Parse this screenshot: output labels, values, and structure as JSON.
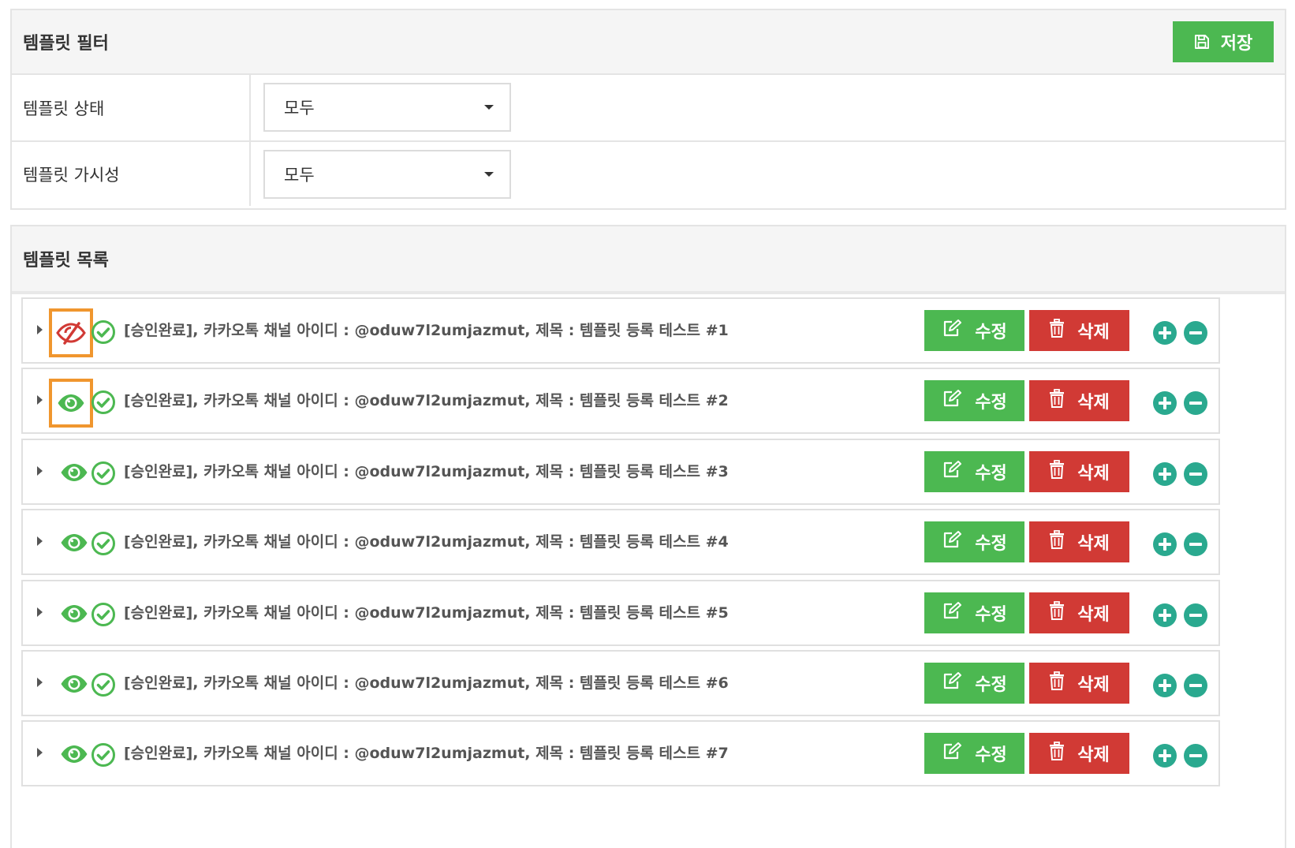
{
  "filter": {
    "title": "템플릿 필터",
    "save_label": "저장",
    "rows": [
      {
        "label": "템플릿 상태",
        "value": "모두"
      },
      {
        "label": "템플릿 가시성",
        "value": "모두"
      }
    ]
  },
  "list": {
    "title": "템플릿 목록",
    "edit_label": "수정",
    "delete_label": "삭제",
    "items": [
      {
        "title": "[승인완료], 카카오톡 채널 아이디 : @oduw7l2umjazmut, 제목 : 템플릿 등록 테스트 #1",
        "visible": false,
        "highlighted": true,
        "eye_icon": "eye-slash-icon"
      },
      {
        "title": "[승인완료], 카카오톡 채널 아이디 : @oduw7l2umjazmut, 제목 : 템플릿 등록 테스트 #2",
        "visible": true,
        "highlighted": true,
        "eye_icon": "eye-icon"
      },
      {
        "title": "[승인완료], 카카오톡 채널 아이디 : @oduw7l2umjazmut, 제목 : 템플릿 등록 테스트 #3",
        "visible": true,
        "highlighted": false,
        "eye_icon": "eye-icon"
      },
      {
        "title": "[승인완료], 카카오톡 채널 아이디 : @oduw7l2umjazmut, 제목 : 템플릿 등록 테스트 #4",
        "visible": true,
        "highlighted": false,
        "eye_icon": "eye-icon"
      },
      {
        "title": "[승인완료], 카카오톡 채널 아이디 : @oduw7l2umjazmut, 제목 : 템플릿 등록 테스트 #5",
        "visible": true,
        "highlighted": false,
        "eye_icon": "eye-icon"
      },
      {
        "title": "[승인완료], 카카오톡 채널 아이디 : @oduw7l2umjazmut, 제목 : 템플릿 등록 테스트 #6",
        "visible": true,
        "highlighted": false,
        "eye_icon": "eye-icon"
      },
      {
        "title": "[승인완료], 카카오톡 채널 아이디 : @oduw7l2umjazmut, 제목 : 템플릿 등록 테스트 #7",
        "visible": true,
        "highlighted": false,
        "eye_icon": "eye-icon"
      }
    ]
  },
  "colors": {
    "success": "#4cb851",
    "danger": "#d13a35",
    "teal": "#2aa98f",
    "highlight": "#f0962e",
    "hidden_eye": "#d13a35"
  }
}
